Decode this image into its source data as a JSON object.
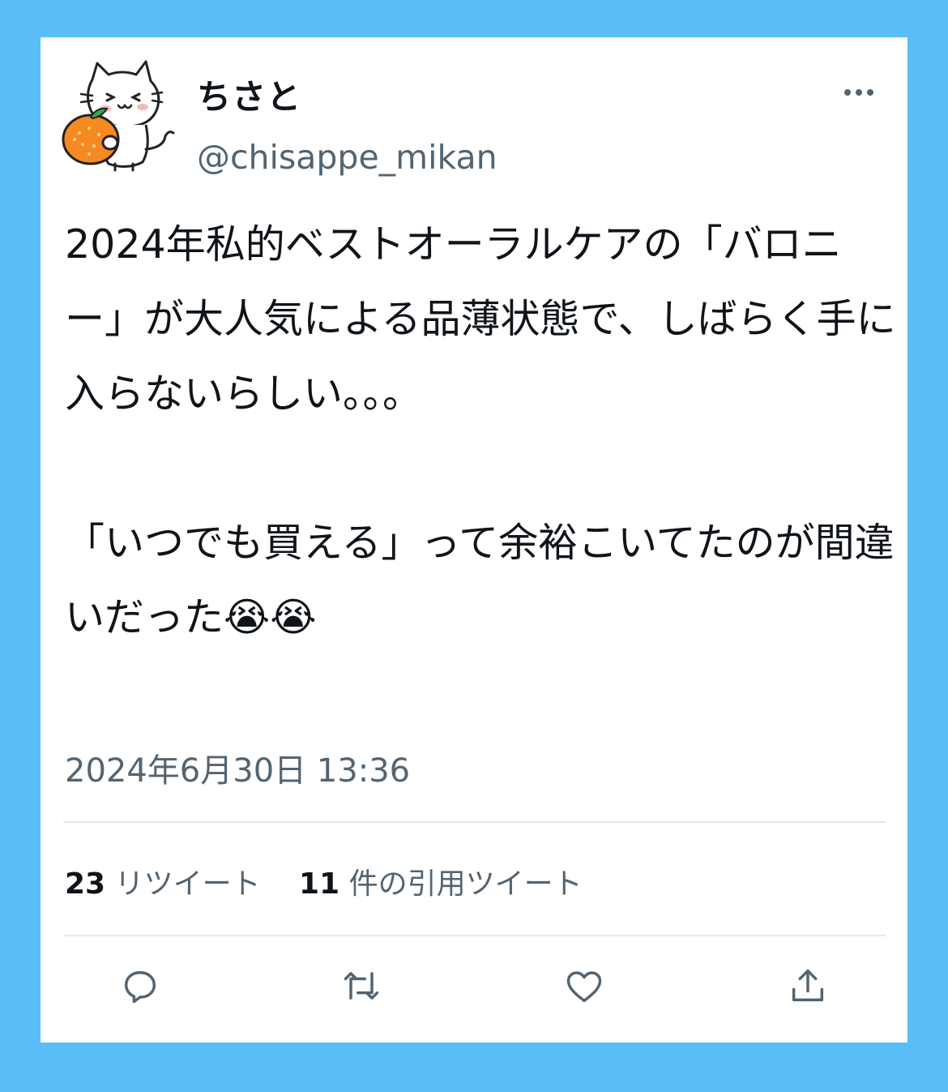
{
  "tweet": {
    "author": {
      "display_name": "ちさと",
      "handle": "@chisappe_mikan",
      "avatar_icon": "cat-holding-orange-avatar"
    },
    "more_icon": "more-options-icon",
    "text": "2024年私的ベストオーラルケアの「バロニー」が大人気による品薄状態で、しばらく手に入らないらしい。。。\n\n「いつでも買える」って余裕こいてたのが間違いだった😭😭",
    "timestamp": "2024年6月30日 13:36",
    "stats": {
      "retweets_count": "23",
      "retweets_label": "リツイート",
      "quotes_count": "11",
      "quotes_label": "件の引用ツイート"
    },
    "actions": [
      {
        "icon": "reply-icon"
      },
      {
        "icon": "retweet-icon"
      },
      {
        "icon": "like-heart-icon"
      },
      {
        "icon": "share-icon"
      }
    ]
  },
  "colors": {
    "background": "#59bdf7",
    "card": "#ffffff",
    "primary_text": "#0f1419",
    "secondary_text": "#536471",
    "divider": "#e4e8eb",
    "orange": "#f58a22"
  }
}
